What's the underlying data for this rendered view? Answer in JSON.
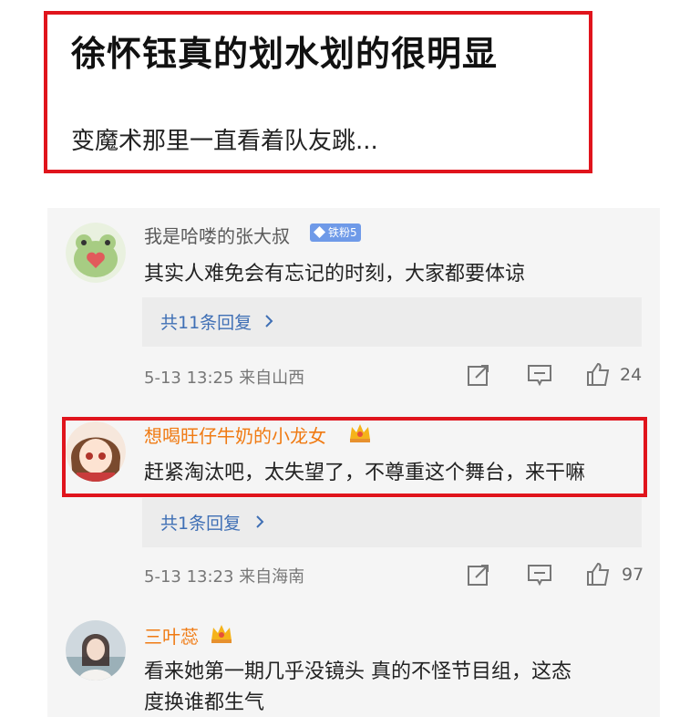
{
  "headline": {
    "title": "徐怀钰真的划水划的很明显",
    "subtitle": "变魔术那里一直看着队友跳..."
  },
  "comments": [
    {
      "username": "我是哈喽的张大叔",
      "badge": "铁粉5",
      "text": "其实人难免会有忘记的时刻，大家都要体谅",
      "replies": "共11条回复",
      "meta": "5-13 13:25  来自山西",
      "likes": "24",
      "avatar_icon": "frog-heart-avatar"
    },
    {
      "username": "想喝旺仔牛奶的小龙女",
      "text": "赶紧淘汰吧，太失望了，不尊重这个舞台，来干嘛",
      "replies": "共1条回复",
      "meta": "5-13 13:23  来自海南",
      "likes": "97",
      "avatar_icon": "anime-girl-avatar"
    },
    {
      "username": "三叶蕊",
      "text_line1": "看来她第一期几乎没镜头  真的不怪节目组，这态",
      "text_line2": "度换谁都生气",
      "avatar_icon": "photo-avatar"
    }
  ],
  "colors": {
    "highlight": "#e0141c",
    "link": "#3f6fb5",
    "vip_name": "#f07a12",
    "badge": "#6f9ae8"
  }
}
